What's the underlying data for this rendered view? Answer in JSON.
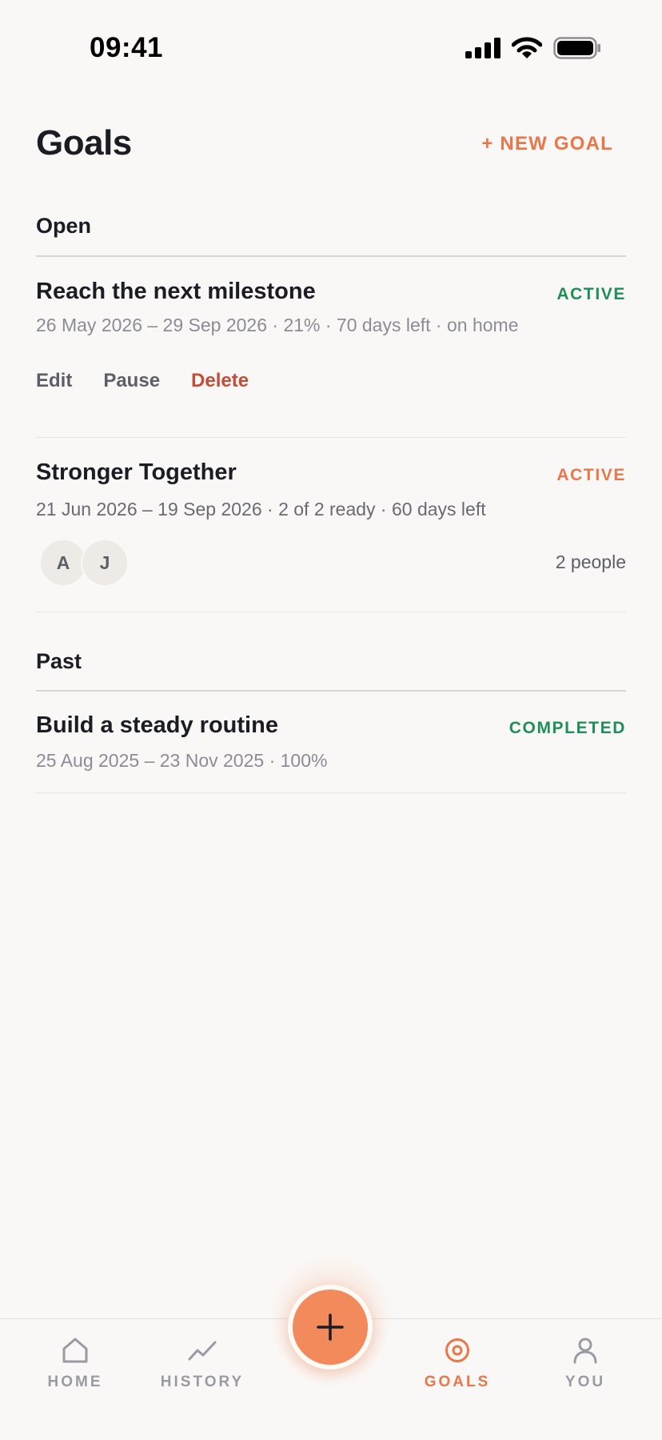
{
  "status_bar": {
    "time": "09:41"
  },
  "header": {
    "title": "Goals",
    "new_goal_label": "+ NEW GOAL"
  },
  "sections": {
    "open_label": "Open",
    "past_label": "Past"
  },
  "goals_open": [
    {
      "title": "Reach the next milestone",
      "status": "ACTIVE",
      "meta": "26 May 2026 – 29 Sep 2026 · 21% · 70 days left · on home",
      "actions": {
        "edit": "Edit",
        "pause": "Pause",
        "delete": "Delete"
      }
    },
    {
      "title": "Stronger Together",
      "status": "ACTIVE",
      "meta": "21 Jun 2026 – 19 Sep 2026 · 2 of 2 ready · 60 days left",
      "avatars": [
        "A",
        "J"
      ],
      "people_count": "2 people"
    }
  ],
  "goals_past": [
    {
      "title": "Build a steady routine",
      "status": "COMPLETED",
      "meta": "25 Aug 2025 – 23 Nov 2025 · 100%"
    }
  ],
  "nav": {
    "home": "HOME",
    "history": "HISTORY",
    "goals": "GOALS",
    "you": "YOU",
    "active": "goals"
  },
  "colors": {
    "accent": "#e9774a",
    "active_green": "#1f8f5a",
    "delete_red": "#c24d3b",
    "background": "#faf8f6"
  },
  "icons": {
    "status": [
      "signal-icon",
      "wifi-icon",
      "battery-icon"
    ],
    "nav": [
      "home-icon",
      "history-icon",
      "goals-icon",
      "you-icon"
    ],
    "fab": "plus-icon"
  }
}
